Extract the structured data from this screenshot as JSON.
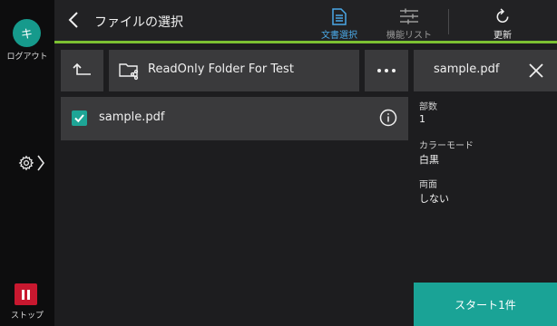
{
  "sidebar": {
    "avatar_initial": "キ",
    "logout_label": "ログアウト",
    "stop_label": "ストップ"
  },
  "header": {
    "title": "ファイルの選択",
    "buttons": [
      {
        "label": "文書選択",
        "icon": "document-icon",
        "active": true
      },
      {
        "label": "機能リスト",
        "icon": "sliders-icon",
        "active": false
      },
      {
        "label": "更新",
        "icon": "refresh-icon",
        "active": false
      }
    ]
  },
  "browser": {
    "folder_name": "ReadOnly Folder For Test",
    "files": [
      {
        "name": "sample.pdf",
        "checked": true
      }
    ]
  },
  "details": {
    "title": "sample.pdf",
    "fields": [
      {
        "label": "部数",
        "value": "1"
      },
      {
        "label": "カラーモード",
        "value": "白黒"
      },
      {
        "label": "両面",
        "value": "しない"
      }
    ],
    "start_label": "スタート1件"
  },
  "colors": {
    "accent_teal": "#1aa396",
    "accent_green": "#7cc132",
    "active_blue": "#4aa8e6",
    "stop_red": "#c8182f"
  }
}
